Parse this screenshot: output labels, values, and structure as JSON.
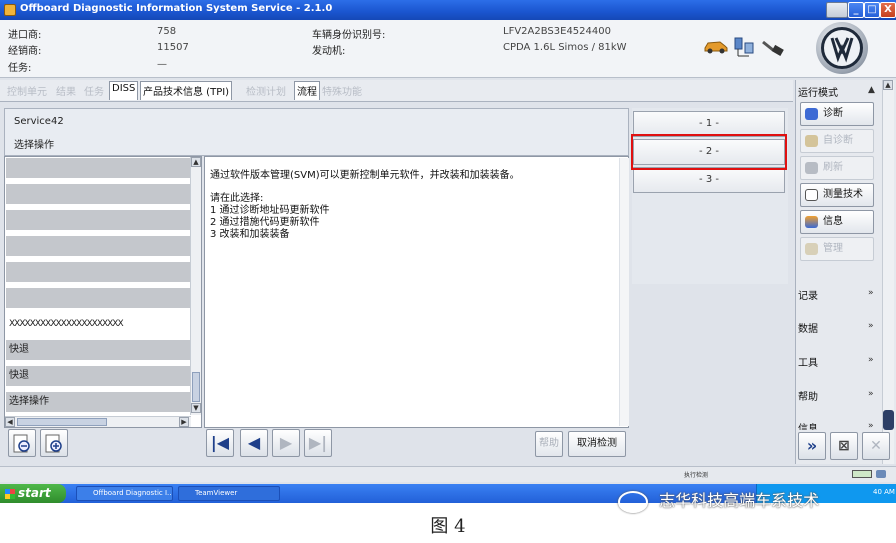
{
  "window": {
    "title": "Offboard Diagnostic Information System Service - 2.1.0",
    "min": "_",
    "max": "□",
    "close": "X"
  },
  "vehicle_info": {
    "importer_label": "进口商:",
    "importer_value": "758",
    "dealer_label": "经销商:",
    "dealer_value": "11507",
    "task_label": "任务:",
    "task_value": "—",
    "vin_label": "车辆身份识别号:",
    "vin_value": "LFV2A2BS3E4524400",
    "engine_label": "发动机:",
    "engine_value": "CPDA 1.6L Simos / 81kW"
  },
  "tabs": [
    {
      "label": "控制单元",
      "state": "disabled"
    },
    {
      "label": "结果",
      "state": "disabled"
    },
    {
      "label": "任务",
      "state": "disabled"
    },
    {
      "label": "DISS",
      "state": "active"
    },
    {
      "label": "产品技术信息 (TPI)",
      "state": "active"
    },
    {
      "label": "检测计划",
      "state": "disabled"
    },
    {
      "label": "流程",
      "state": "active"
    },
    {
      "label": "特殊功能",
      "state": "disabled"
    }
  ],
  "header": {
    "service": "Service42",
    "step": "选择操作"
  },
  "options": [
    "- 1 -",
    "- 2 -",
    "- 3 -"
  ],
  "left_list": [
    "",
    "",
    "",
    "",
    "",
    "",
    "",
    "XXXXXXXXXXXXXXXXXXXXXX",
    "快退",
    "快退",
    "选择操作"
  ],
  "text_lines": [
    "通过软件版本管理(SVM)可以更新控制单元软件，并改装和加装装备。",
    "请在此选择:",
    "1 通过诊断地址码更新软件",
    "2 通过措施代码更新软件",
    "3 改装和加装装备"
  ],
  "buttons": {
    "help": "帮助",
    "cancel": "取消检测"
  },
  "sidebar": {
    "mode_title": "运行模式",
    "diagnose": "诊断",
    "self_diagnose": "自诊断",
    "refresh": "刷新",
    "measure": "测量技术",
    "info_btn": "信息",
    "admin": "管理",
    "record": "记录",
    "data": "数据",
    "tools": "工具",
    "help": "帮助",
    "info": "信息"
  },
  "status": {
    "text": "执行检测"
  },
  "taskbar": {
    "start": "start",
    "app1": "Offboard Diagnostic I...",
    "app2": "TeamViewer",
    "clock": "40 AM"
  },
  "watermark": "志华科技高端车系技术",
  "caption": "图 4"
}
